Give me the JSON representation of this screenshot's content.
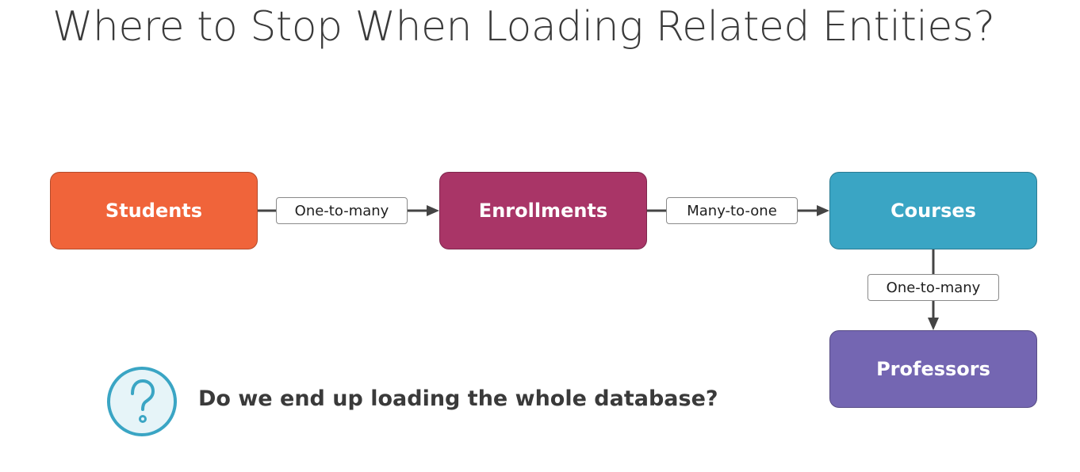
{
  "title": "Where to Stop When Loading Related Entities?",
  "nodes": {
    "students": {
      "label": "Students",
      "color": "#f0643a"
    },
    "enrollments": {
      "label": "Enrollments",
      "color": "#a93567"
    },
    "courses": {
      "label": "Courses",
      "color": "#3aa5c4"
    },
    "professors": {
      "label": "Professors",
      "color": "#7466b2"
    }
  },
  "relations": [
    {
      "from": "Students",
      "to": "Enrollments",
      "label": "One-to-many"
    },
    {
      "from": "Enrollments",
      "to": "Courses",
      "label": "Many-to-one"
    },
    {
      "from": "Courses",
      "to": "Professors",
      "label": "One-to-many"
    }
  ],
  "question": {
    "icon": "question-mark-icon",
    "text": "Do we end up loading the whole database?",
    "accent": "#3aa5c4"
  }
}
